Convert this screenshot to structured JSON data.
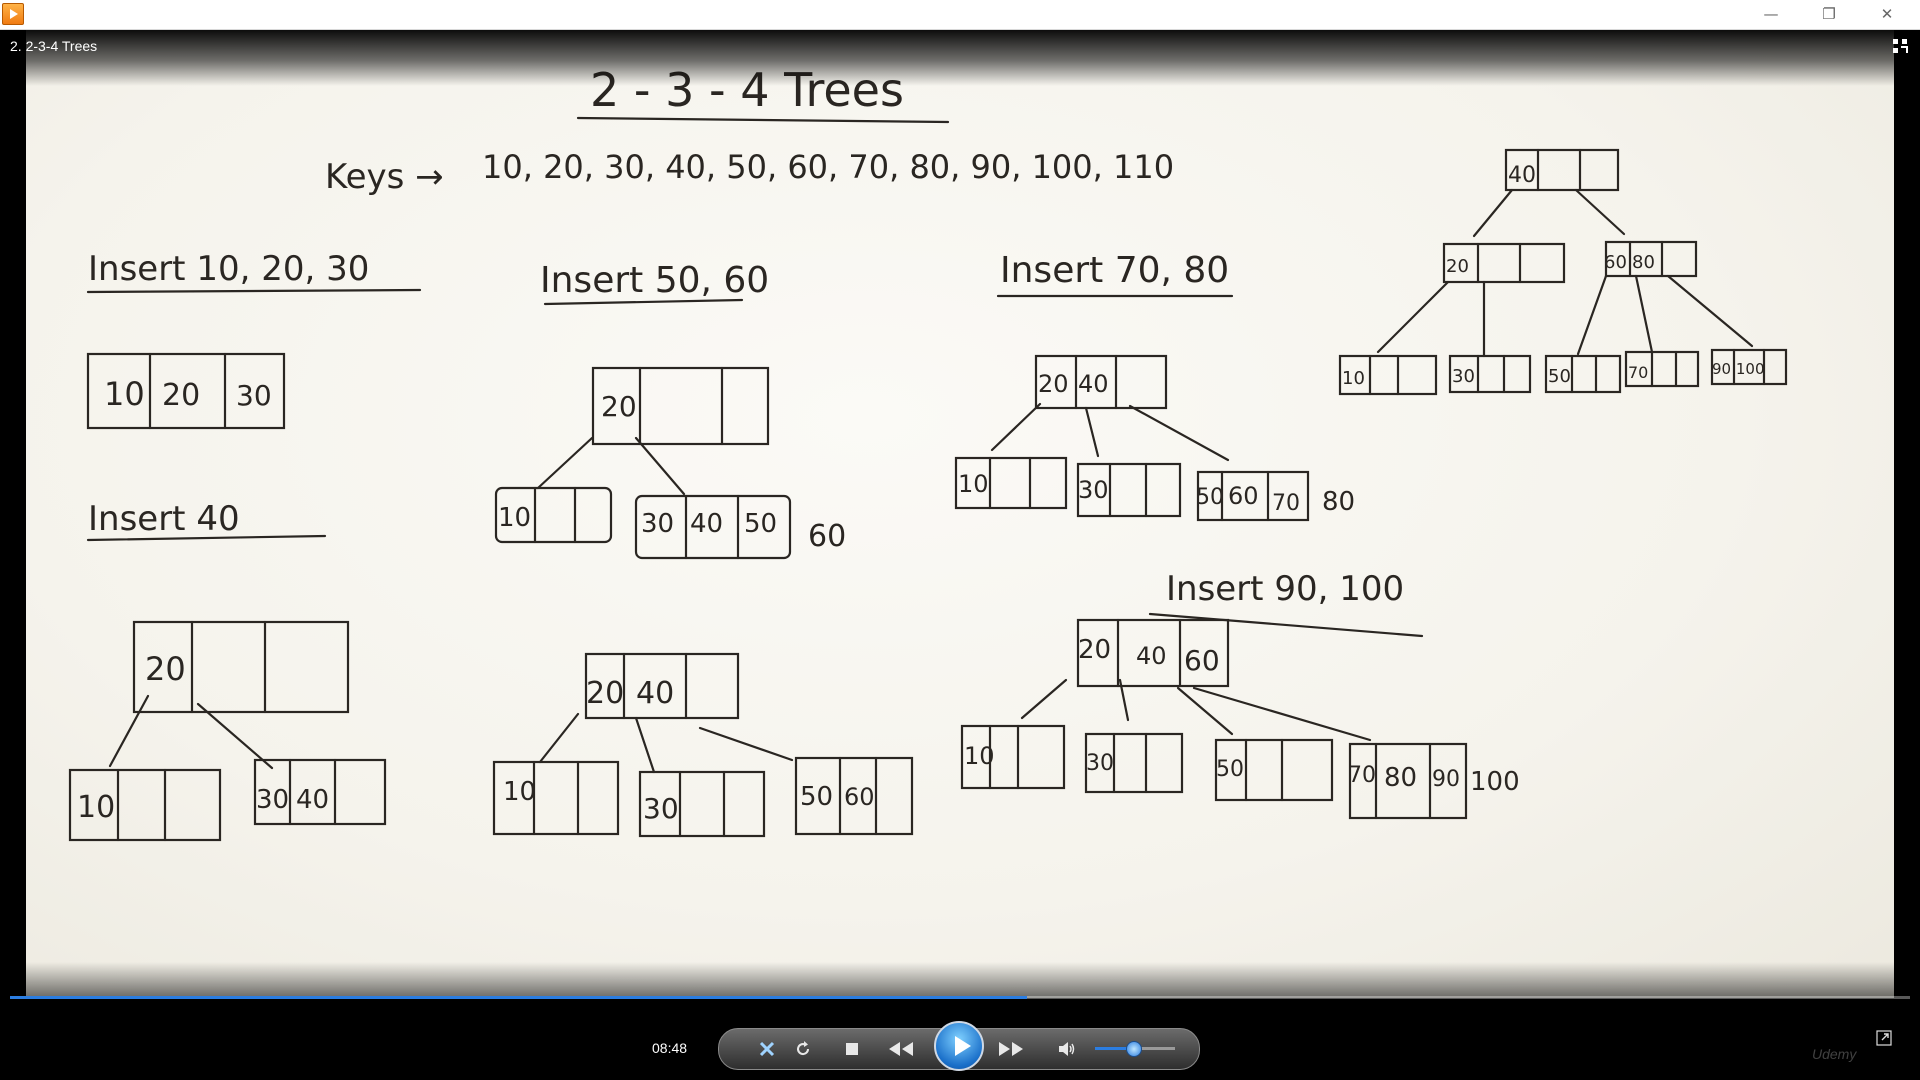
{
  "window": {
    "controls": {
      "minimize": "—",
      "restore": "❐",
      "close": "✕"
    }
  },
  "video": {
    "title": "2. 2-3-4 Trees",
    "progress_fraction": 0.535
  },
  "board": {
    "heading": "2 - 3 - 4  Trees",
    "keys_label": "Keys →",
    "keys_list": "10, 20, 30, 40, 50, 60, 70, 80, 90, 100, 110",
    "step1_title": "Insert 10, 20, 30",
    "step1_node": [
      "10",
      "20",
      "30"
    ],
    "step2_title": "Insert 40",
    "step2_root": "20",
    "step2_left": "10",
    "step2_right": [
      "30",
      "40"
    ],
    "step3_title": "Insert 50, 60",
    "step3_root": "20",
    "step3_left": "10",
    "step3_right": [
      "30",
      "40",
      "50"
    ],
    "step3_pending": "60",
    "step3b_root": [
      "20",
      "40"
    ],
    "step3b_children": [
      [
        "10"
      ],
      [
        "30"
      ],
      [
        "50",
        "60"
      ]
    ],
    "step4_title": "Insert 70, 80",
    "step4_root": [
      "20",
      "40"
    ],
    "step4_children": [
      [
        "10"
      ],
      [
        "30"
      ],
      [
        "50",
        "60",
        "70"
      ]
    ],
    "step4_pending": "80",
    "step5_title": "Insert 90, 100",
    "step5_root": [
      "20",
      "40",
      "60"
    ],
    "step5_children": [
      [
        "10"
      ],
      [
        "30"
      ],
      [
        "50"
      ],
      [
        "70",
        "80",
        "90"
      ]
    ],
    "step5_pending": "100",
    "step6_root": "40",
    "step6_mid": [
      [
        "20"
      ],
      [
        "60",
        "80"
      ]
    ],
    "step6_leaves": [
      "10",
      "30",
      "50",
      "70",
      "90 100"
    ]
  },
  "player": {
    "time": "08:48",
    "volume_fraction": 0.45,
    "watermark": "Udemy"
  },
  "icons": {
    "app": "media-player-icon",
    "compact": "compact-mode-icon",
    "switch": "switch-to-library-icon",
    "repeat": "repeat-icon",
    "stop": "stop-icon",
    "prev": "rewind-icon",
    "play": "play-icon",
    "next": "fast-forward-icon",
    "volume": "volume-icon",
    "expand": "fullscreen-icon"
  }
}
